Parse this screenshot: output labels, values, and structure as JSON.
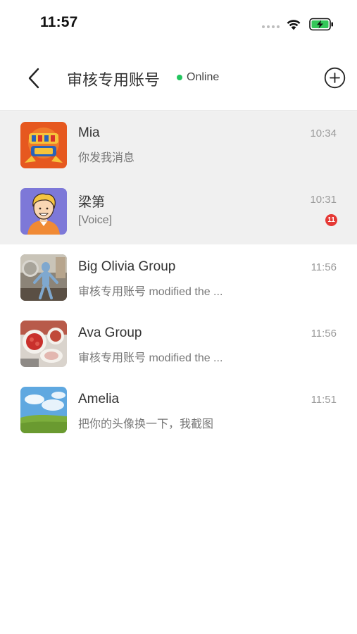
{
  "status_bar": {
    "time": "11:57",
    "icons": [
      "signal-dots-icon",
      "wifi-icon",
      "battery-charging-icon"
    ],
    "battery_color": "#34c759"
  },
  "header": {
    "back_icon": "chevron-left-icon",
    "title": "审核专用账号",
    "status_text": "Online",
    "status_color": "#22c55e",
    "add_icon": "plus-circle-icon"
  },
  "chats": [
    {
      "name": "Mia",
      "preview": "你发我消息",
      "time": "10:34",
      "pinned": true,
      "avatar": "game-logo-avatar"
    },
    {
      "name": "梁第",
      "preview": "[Voice]",
      "time": "10:31",
      "pinned": true,
      "unread": "11",
      "avatar": "cartoon-person-avatar"
    },
    {
      "name": "Big Olivia Group",
      "preview": "审核专用账号 modified the ...",
      "time": "11:56",
      "pinned": false,
      "avatar": "photo-plush-toy-avatar"
    },
    {
      "name": "Ava Group",
      "preview": "审核专用账号 modified the ...",
      "time": "11:56",
      "pinned": false,
      "avatar": "photo-food-avatar"
    },
    {
      "name": "Amelia",
      "preview": "把你的头像换一下，我截图",
      "time": "11:51",
      "pinned": false,
      "avatar": "photo-landscape-avatar"
    }
  ],
  "colors": {
    "pinned_background": "#f0f0f0",
    "badge": "#e53935",
    "name_text": "#333333",
    "preview_text": "#777777",
    "time_text": "#9a9a9a"
  }
}
